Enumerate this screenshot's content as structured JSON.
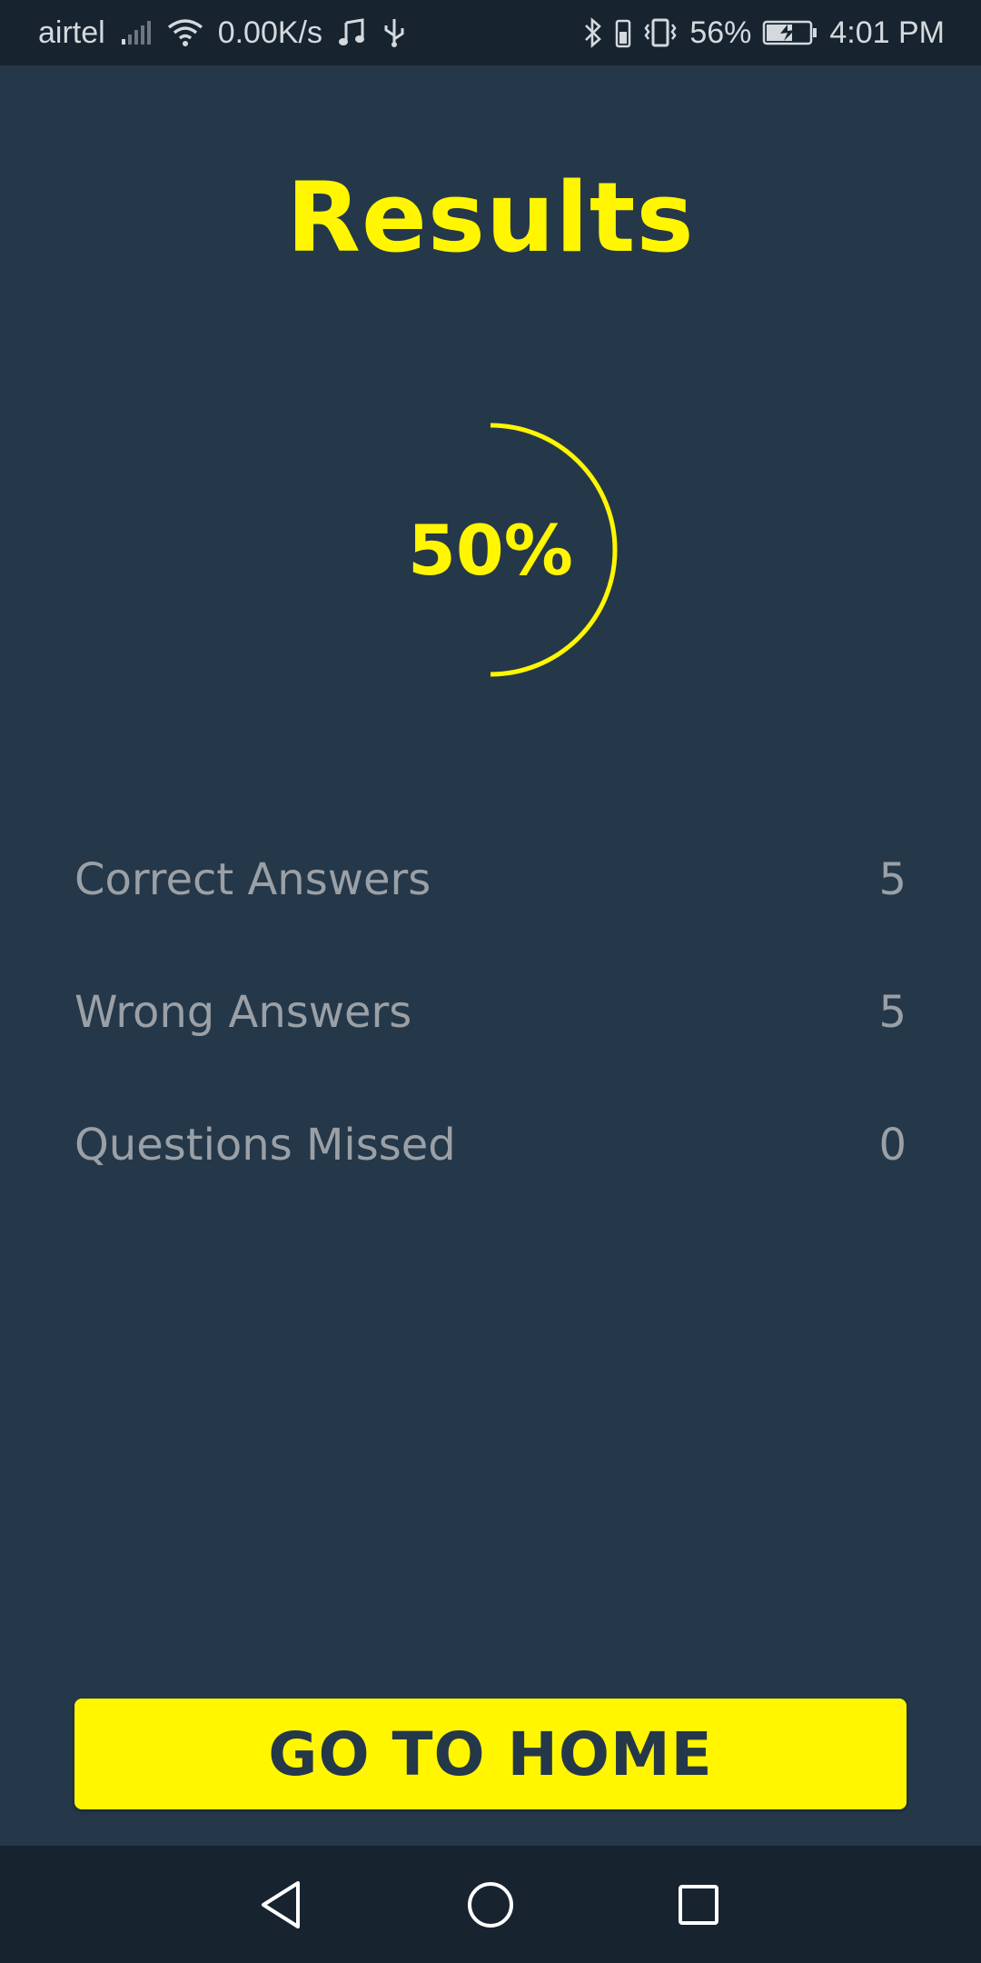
{
  "status_bar": {
    "carrier": "airtel",
    "network_speed": "0.00K/s",
    "battery_percent": "56%",
    "time": "4:01 PM",
    "icons": [
      "signal-icon",
      "wifi-icon",
      "music-icon",
      "usb-icon",
      "bluetooth-icon",
      "vibrate-icon",
      "battery-charging-icon"
    ]
  },
  "page": {
    "title": "Results"
  },
  "score": {
    "percent_label": "50%",
    "percent_value": 0.5,
    "color": "#fff600"
  },
  "stats": [
    {
      "label": "Correct Answers",
      "value": "5"
    },
    {
      "label": "Wrong Answers",
      "value": "5"
    },
    {
      "label": "Questions Missed",
      "value": "0"
    }
  ],
  "actions": {
    "home_button": "GO TO HOME"
  },
  "nav_bar": {
    "icons": [
      "back-icon",
      "home-icon",
      "recents-icon"
    ]
  },
  "colors": {
    "background": "#253849",
    "accent": "#fff600",
    "bars": "#17232f",
    "stat_text": "#9aa0a6"
  }
}
